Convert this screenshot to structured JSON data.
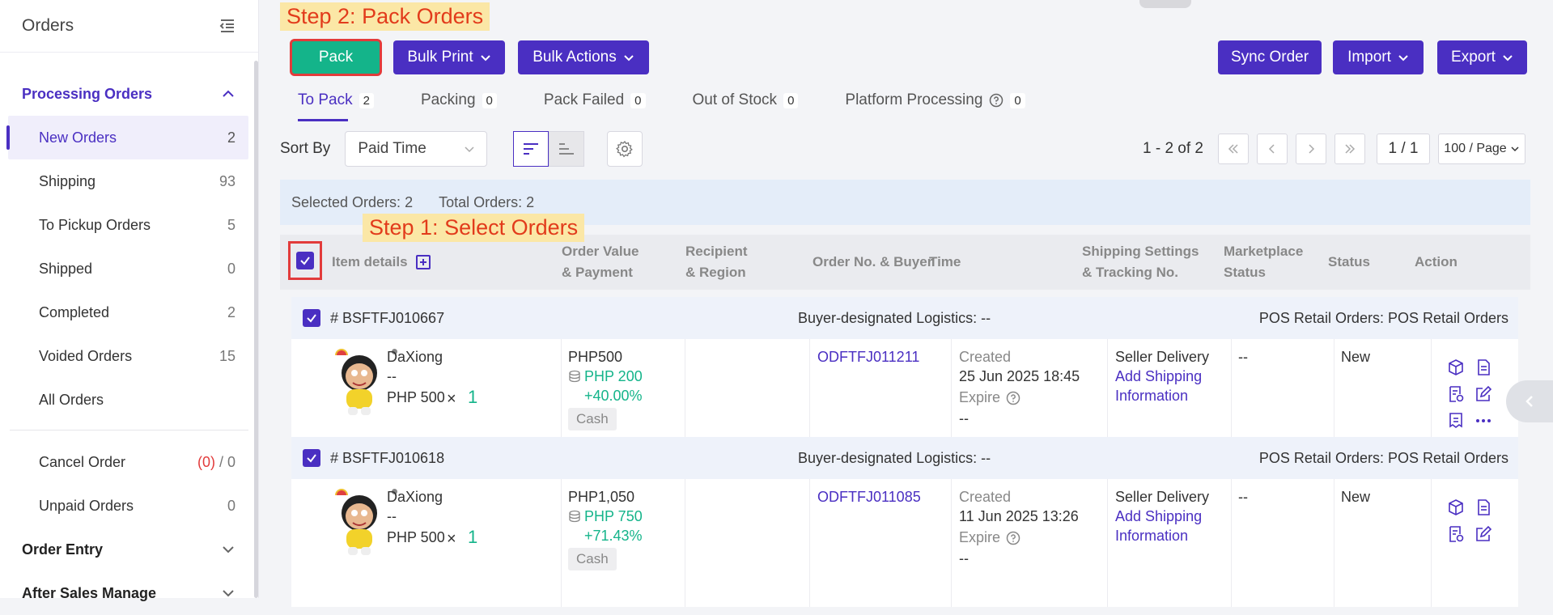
{
  "sidebar": {
    "title": "Orders",
    "groups": [
      {
        "label": "Processing Orders"
      },
      {
        "label": "Order Entry"
      },
      {
        "label": "After Sales Manage"
      }
    ],
    "items": [
      {
        "label": "New Orders",
        "count": "2"
      },
      {
        "label": "Shipping",
        "count": "93"
      },
      {
        "label": "To Pickup Orders",
        "count": "5"
      },
      {
        "label": "Shipped",
        "count": "0"
      },
      {
        "label": "Completed",
        "count": "2"
      },
      {
        "label": "Voided Orders",
        "count": "15"
      },
      {
        "label": "All Orders",
        "count": ""
      }
    ],
    "cancel": {
      "label": "Cancel Order",
      "red_count": "(0)",
      "sep": " / ",
      "count": "0"
    },
    "unpaid": {
      "label": "Unpaid Orders",
      "count": "0"
    }
  },
  "annotations": {
    "step1": "Step 1: Select Orders",
    "step2": "Step 2: Pack Orders"
  },
  "toolbar": {
    "pack": "Pack",
    "bulk_print": "Bulk Print",
    "bulk_actions": "Bulk Actions",
    "sync": "Sync Order",
    "import": "Import",
    "export": "Export"
  },
  "tabs": [
    {
      "label": "To Pack",
      "count": "2"
    },
    {
      "label": "Packing",
      "count": "0"
    },
    {
      "label": "Pack Failed",
      "count": "0"
    },
    {
      "label": "Out of Stock",
      "count": "0"
    },
    {
      "label": "Platform Processing",
      "count": "0"
    }
  ],
  "sort": {
    "label": "Sort By",
    "value": "Paid Time"
  },
  "pager": {
    "info": "1 - 2 of 2",
    "page": "1 / 1",
    "size": "100 / Page"
  },
  "selection": {
    "selected": "Selected Orders: 2",
    "total": "Total Orders: 2"
  },
  "columns": {
    "item": "Item details",
    "value": [
      "Order Value",
      "& Payment"
    ],
    "recipient": [
      "Recipient",
      "& Region"
    ],
    "orderno": "Order No. & Buyer",
    "time": "Time",
    "shipping": [
      "Shipping Settings",
      "& Tracking No."
    ],
    "market": [
      "Marketplace",
      "Status"
    ],
    "status": "Status",
    "action": "Action"
  },
  "orders": [
    {
      "id": "# BSFTFJ010667",
      "logistics": "Buyer-designated Logistics: --",
      "source": "POS Retail Orders: POS Retail Orders",
      "product": "DaXiong",
      "variant": "--",
      "price": "PHP 500",
      "times": "×",
      "qty": "1",
      "value": "PHP500",
      "cost": "PHP 200",
      "margin": "+40.00%",
      "payment": "Cash",
      "order_no": "ODFTFJ011211",
      "created_label": "Created",
      "created": "25 Jun 2025 18:45",
      "expire_label": "Expire",
      "expire": "--",
      "ship": "Seller Delivery",
      "ship_link1": "Add Shipping",
      "ship_link2": "Information",
      "market": "--",
      "status": "New"
    },
    {
      "id": "# BSFTFJ010618",
      "logistics": "Buyer-designated Logistics: --",
      "source": "POS Retail Orders: POS Retail Orders",
      "product": "DaXiong",
      "variant": "--",
      "price": "PHP 500",
      "times": "×",
      "qty": "1",
      "value": "PHP1,050",
      "cost": "PHP 750",
      "margin": "+71.43%",
      "payment": "Cash",
      "order_no": "ODFTFJ011085",
      "created_label": "Created",
      "created": "11 Jun 2025 13:26",
      "expire_label": "Expire",
      "expire": "--",
      "ship": "Seller Delivery",
      "ship_link1": "Add Shipping",
      "ship_link2": "Information",
      "market": "--",
      "status": "New"
    }
  ],
  "colors": {
    "accent": "#4a2fc2",
    "pack": "#14b48a",
    "highlight_border": "#e23b3b",
    "note_bg": "#fbe7a6"
  }
}
